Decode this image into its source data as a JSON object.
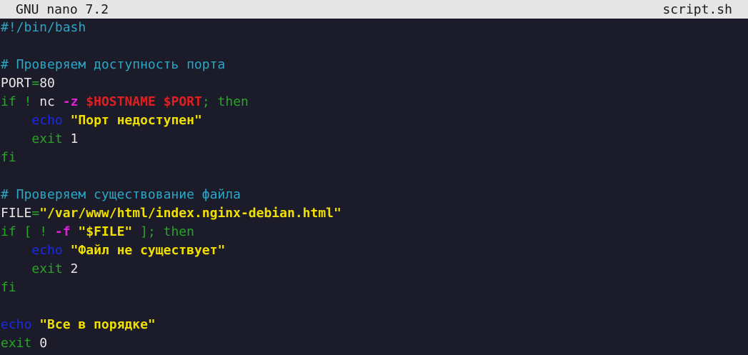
{
  "titlebar": {
    "app": "GNU nano 7.2",
    "filename": "script.sh"
  },
  "lines": [
    [
      {
        "t": "#!/bin/bash",
        "c": "comment"
      }
    ],
    [],
    [
      {
        "t": "# Проверяем доступность порта",
        "c": "comment"
      }
    ],
    [
      {
        "t": "PORT",
        "c": "plain"
      },
      {
        "t": "=",
        "c": "op"
      },
      {
        "t": "80",
        "c": "num"
      }
    ],
    [
      {
        "t": "if",
        "c": "keyword"
      },
      {
        "t": " ",
        "c": "plain"
      },
      {
        "t": "!",
        "c": "keyword"
      },
      {
        "t": " nc ",
        "c": "plain"
      },
      {
        "t": "-z",
        "c": "opt"
      },
      {
        "t": " ",
        "c": "plain"
      },
      {
        "t": "$HOSTNAME",
        "c": "var"
      },
      {
        "t": " ",
        "c": "plain"
      },
      {
        "t": "$PORT",
        "c": "var"
      },
      {
        "t": "; then",
        "c": "keyword"
      }
    ],
    [
      {
        "t": "    ",
        "c": "plain"
      },
      {
        "t": "echo",
        "c": "builtin"
      },
      {
        "t": " ",
        "c": "plain"
      },
      {
        "t": "\"Порт недоступен\"",
        "c": "string"
      }
    ],
    [
      {
        "t": "    ",
        "c": "plain"
      },
      {
        "t": "exit",
        "c": "keyword"
      },
      {
        "t": " 1",
        "c": "num"
      }
    ],
    [
      {
        "t": "fi",
        "c": "keyword"
      }
    ],
    [],
    [
      {
        "t": "# Проверяем существование файла",
        "c": "comment"
      }
    ],
    [
      {
        "t": "FILE",
        "c": "plain"
      },
      {
        "t": "=",
        "c": "op"
      },
      {
        "t": "\"/var/www/html/index.nginx-debian.html\"",
        "c": "string"
      }
    ],
    [
      {
        "t": "if [ ",
        "c": "keyword"
      },
      {
        "t": "! ",
        "c": "keyword"
      },
      {
        "t": "-f",
        "c": "opt"
      },
      {
        "t": " ",
        "c": "plain"
      },
      {
        "t": "\"$FILE\"",
        "c": "string"
      },
      {
        "t": " ]; then",
        "c": "keyword"
      }
    ],
    [
      {
        "t": "    ",
        "c": "plain"
      },
      {
        "t": "echo",
        "c": "builtin"
      },
      {
        "t": " ",
        "c": "plain"
      },
      {
        "t": "\"Файл не существует\"",
        "c": "string"
      }
    ],
    [
      {
        "t": "    ",
        "c": "plain"
      },
      {
        "t": "exit",
        "c": "keyword"
      },
      {
        "t": " 2",
        "c": "num"
      }
    ],
    [
      {
        "t": "fi",
        "c": "keyword"
      }
    ],
    [],
    [
      {
        "t": "echo",
        "c": "builtin"
      },
      {
        "t": " ",
        "c": "plain"
      },
      {
        "t": "\"Все в порядке\"",
        "c": "string"
      }
    ],
    [
      {
        "t": "exit",
        "c": "keyword"
      },
      {
        "t": " 0",
        "c": "num"
      }
    ]
  ],
  "colors": {
    "background": "#1c1b2a",
    "titlebar_bg": "#e6e6e6",
    "comment": "#2aa8c6",
    "keyword": "#27a627",
    "option": "#e020d8",
    "variable": "#e02020",
    "string": "#f0e000",
    "builtin": "#1a2ae6"
  }
}
